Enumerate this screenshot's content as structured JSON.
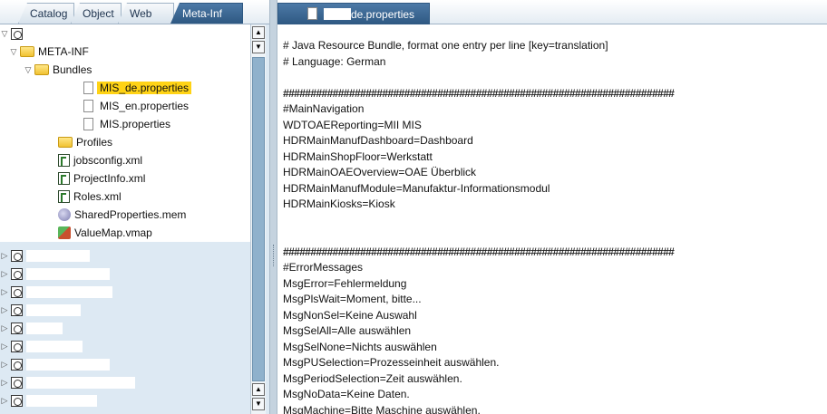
{
  "left_tabs": [
    "Catalog",
    "Object",
    "Web",
    "Meta-Inf"
  ],
  "tree": {
    "meta_inf": "META-INF",
    "bundles": "Bundles",
    "files": [
      "MIS_de.properties",
      "MIS_en.properties",
      "MIS.properties"
    ],
    "profiles": "Profiles",
    "items": [
      "jobsconfig.xml",
      "ProjectInfo.xml",
      "Roles.xml",
      "SharedProperties.mem",
      "ValueMap.vmap"
    ]
  },
  "scroll": {
    "up": "▲",
    "down": "▼"
  },
  "editor": {
    "tab_label": "de.properties",
    "lines": [
      "# Java Resource Bundle, format one entry per line [key=translation]",
      "# Language: German",
      "",
      "#######################################################################",
      "#MainNavigation",
      "WDTOAEReporting=MII MIS",
      "HDRMainManufDashboard=Dashboard",
      "HDRMainShopFloor=Werkstatt",
      "HDRMainOAEOverview=OAE Überblick",
      "HDRMainManufModule=Manufaktur-Informationsmodul",
      "HDRMainKiosks=Kiosk",
      "",
      "",
      "#######################################################################",
      "#ErrorMessages",
      "MsgError=Fehlermeldung",
      "MsgPlsWait=Moment, bitte...",
      "MsgNonSel=Keine Auswahl",
      "MsgSelAll=Alle auswählen",
      "MsgSelNone=Nichts auswählen",
      "MsgPUSelection=Prozesseinheit auswählen.",
      "MsgPeriodSelection=Zeit auswählen.",
      "MsgNoData=Keine Daten.",
      "MsgMachine=Bitte Maschine auswählen."
    ]
  }
}
